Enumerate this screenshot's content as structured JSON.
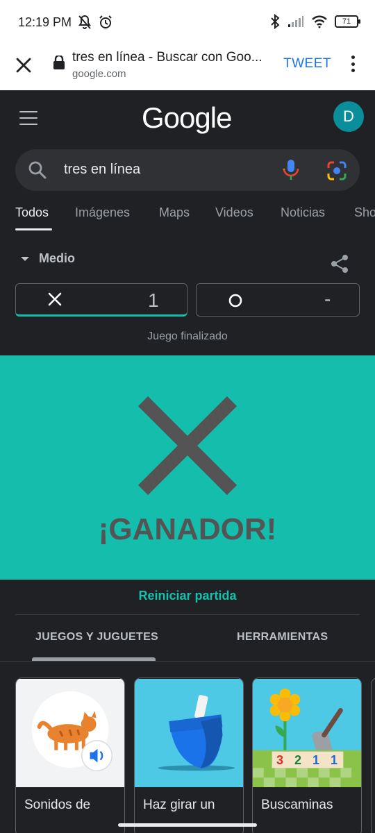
{
  "status_bar": {
    "time": "12:19 PM",
    "battery": "71"
  },
  "browser": {
    "page_title": "tres en línea - Buscar con Goo...",
    "url": "google.com",
    "tweet_label": "TWEET"
  },
  "header": {
    "logo": "Google",
    "avatar_letter": "D"
  },
  "search": {
    "query": "tres en línea"
  },
  "nav_tabs": [
    "Todos",
    "Imágenes",
    "Maps",
    "Videos",
    "Noticias",
    "Sho"
  ],
  "game": {
    "difficulty": "Medio",
    "x_score": "1",
    "o_score": "-",
    "status": "Juego finalizado",
    "winner_text": "¡GANADOR!",
    "restart_label": "Reiniciar partida"
  },
  "categories": [
    "JUEGOS Y JUGUETES",
    "HERRAMIENTAS"
  ],
  "cards": [
    {
      "label": "Sonidos de"
    },
    {
      "label": "Haz girar un"
    },
    {
      "label": "Buscaminas"
    }
  ],
  "minesweeper_numbers": [
    "3",
    "2",
    "1",
    "1"
  ],
  "colors": {
    "accent_teal": "#15c1ac",
    "winner_bg": "#14bdac",
    "dark_bg": "#202124",
    "avatar_bg": "#0a8e9a",
    "tweet_blue": "#1a73e8"
  }
}
